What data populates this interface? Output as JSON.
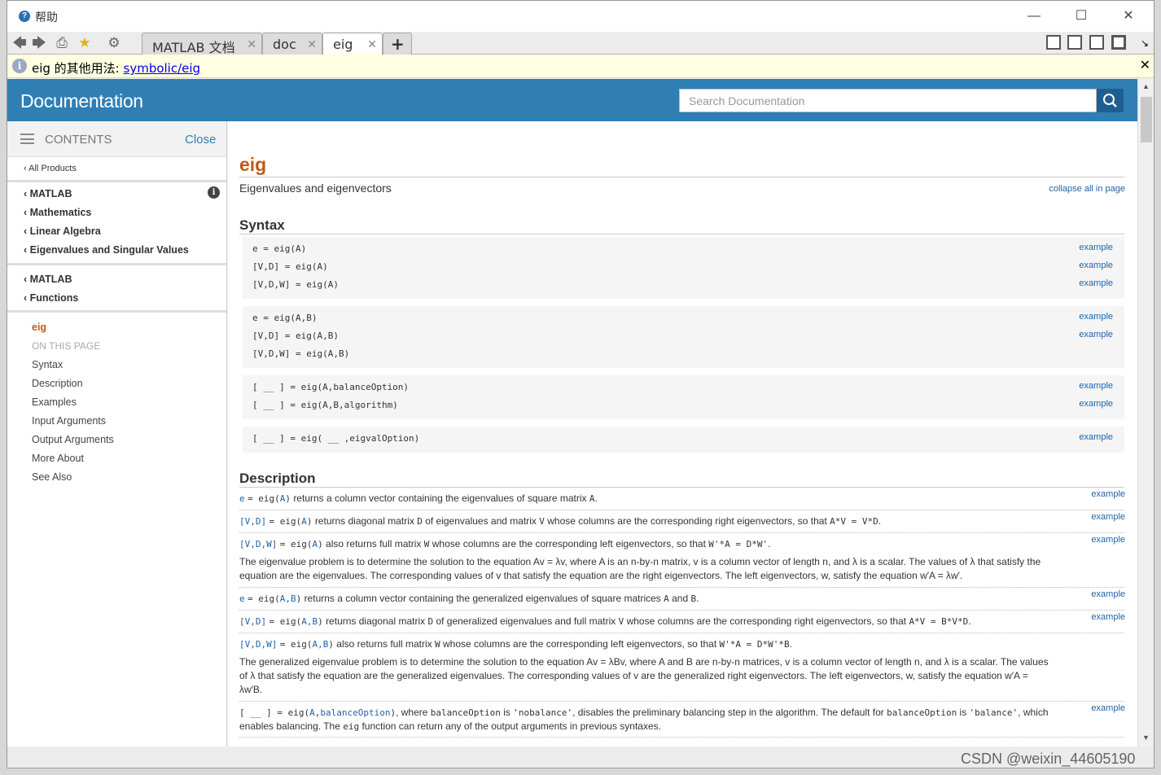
{
  "window": {
    "title": "帮助"
  },
  "toolbar": {
    "tabs": [
      {
        "label": "MATLAB 文档"
      },
      {
        "label": "doc"
      },
      {
        "label": "eig"
      }
    ],
    "new_tab": "+",
    "close_glyph": "✕"
  },
  "infobar": {
    "prefix": "eig 的其他用法: ",
    "link": "symbolic/eig"
  },
  "header": {
    "title": "Documentation",
    "search_placeholder": "Search Documentation"
  },
  "sidebar": {
    "contents": "CONTENTS",
    "close": "Close",
    "all_products": "All Products",
    "group1": [
      "MATLAB",
      "Mathematics",
      "Linear Algebra",
      "Eigenvalues and Singular Values"
    ],
    "group2": [
      "MATLAB",
      "Functions"
    ],
    "current": "eig",
    "on_this_page": "ON THIS PAGE",
    "page_links": [
      "Syntax",
      "Description",
      "Examples",
      "Input Arguments",
      "Output Arguments",
      "More About",
      "See Also"
    ]
  },
  "page": {
    "title": "eig",
    "subtitle": "Eigenvalues and eigenvectors",
    "collapse": "collapse all in page",
    "syntax_heading": "Syntax",
    "example": "example",
    "syntax_lines": [
      "e = eig(A)",
      "[V,D] = eig(A)",
      "[V,D,W] = eig(A)",
      "e = eig(A,B)",
      "[V,D] = eig(A,B)",
      "[V,D,W] = eig(A,B)",
      "[ __ ] = eig(A,balanceOption)",
      "[ __ ] = eig(A,B,algorithm)",
      "[ __ ] = eig( __ ,eigvalOption)"
    ],
    "description_heading": "Description",
    "desc": {
      "d1": "returns a column vector containing the eigenvalues of square matrix",
      "d2a": "returns diagonal matrix",
      "d2b": "of eigenvalues and matrix",
      "d2c": "whose columns are the corresponding right eigenvectors, so that",
      "d3a": "also returns full matrix",
      "d3b": "whose columns are the corresponding left eigenvectors, so that",
      "p1": "The eigenvalue problem is to determine the solution to the equation Av = λv, where A is an n-by-n matrix, v is a column vector of length n, and λ is a scalar. The values of λ that satisfy the equation are the eigenvalues. The corresponding values of v that satisfy the equation are the right eigenvectors. The left eigenvectors, w, satisfy the equation w′A = λw′.",
      "d4": "returns a column vector containing the generalized eigenvalues of square matrices",
      "d5a": "returns diagonal matrix",
      "d5b": "of generalized eigenvalues and full matrix",
      "d5c": "whose columns are the corresponding right eigenvectors, so that",
      "d6a": "also returns full matrix",
      "d6b": "whose columns are the corresponding left eigenvectors, so that",
      "p2": "The generalized eigenvalue problem is to determine the solution to the equation Av = λBv, where A and B are n-by-n matrices, v is a column vector of length n, and λ is a scalar. The values of λ that satisfy the equation are the generalized eigenvalues. The corresponding values of v are the generalized right eigenvectors. The left eigenvectors, w, satisfy the equation w′A = λw′B.",
      "d7a": "where",
      "d7b": "is",
      "d7c": "disables the preliminary balancing step in the algorithm. The default for",
      "d7d": "which enables balancing. The",
      "d7e": "function can return any of the output arguments in previous syntaxes."
    }
  },
  "watermark": "CSDN @weixin_44605190"
}
